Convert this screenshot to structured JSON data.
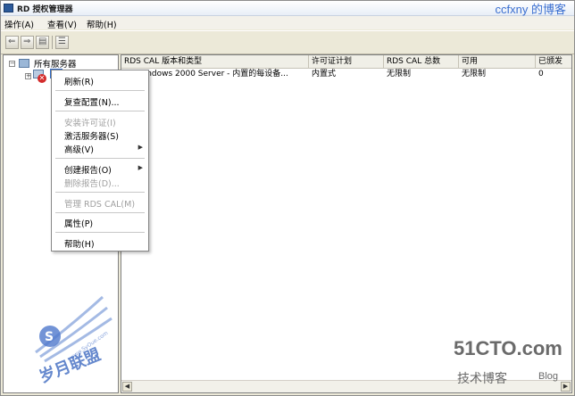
{
  "window": {
    "title": "RD 授权管理器",
    "title_icon": "rd-license-icon"
  },
  "watermark_top": "ccfxny 的博客",
  "menubar": [
    {
      "label": "操作(A)"
    },
    {
      "label": "查看(V)"
    },
    {
      "label": "帮助(H)"
    }
  ],
  "toolbar": {
    "icons": [
      "back-icon",
      "forward-icon",
      "show-hide-tree-icon",
      "list-view-icon"
    ]
  },
  "tree": {
    "root": {
      "label": "所有服务器",
      "expander": "⊟"
    },
    "child": {
      "expander": "⊞",
      "status": "x"
    }
  },
  "columns": [
    {
      "label": "RDS CAL 版本和类型"
    },
    {
      "label": "许可证计划"
    },
    {
      "label": "RDS CAL 总数"
    },
    {
      "label": "可用"
    },
    {
      "label": "已颁发"
    }
  ],
  "rows": [
    {
      "version": "Windows 2000 Server - 内置的每设备...",
      "plan": "内置式",
      "total": "无限制",
      "available": "无限制",
      "issued": "0"
    }
  ],
  "context_menu": [
    {
      "label": "刷新(R)",
      "disabled": false
    },
    {
      "label": "复查配置(N)...",
      "disabled": false
    },
    {
      "label": "安装许可证(I)",
      "disabled": true
    },
    {
      "label": "激活服务器(S)",
      "disabled": false
    },
    {
      "label": "高级(V)",
      "disabled": false,
      "submenu": true
    },
    {
      "label": "创建报告(O)",
      "disabled": false,
      "submenu": true
    },
    {
      "label": "删除报告(D)...",
      "disabled": true
    },
    {
      "label": "管理 RDS CAL(M)",
      "disabled": true
    },
    {
      "label": "属性(P)",
      "disabled": false
    },
    {
      "label": "帮助(H)",
      "disabled": false
    }
  ],
  "watermarks": {
    "logo_text": "岁月联盟",
    "logo_url": "www.SyOue.com",
    "site": "51CTO.com",
    "blog_cn": "技术博客",
    "blog_en": "Blog"
  },
  "colors": {
    "selection": "#316ac5",
    "error": "#d32b2b",
    "watermark_blue": "#3f6bc1"
  }
}
